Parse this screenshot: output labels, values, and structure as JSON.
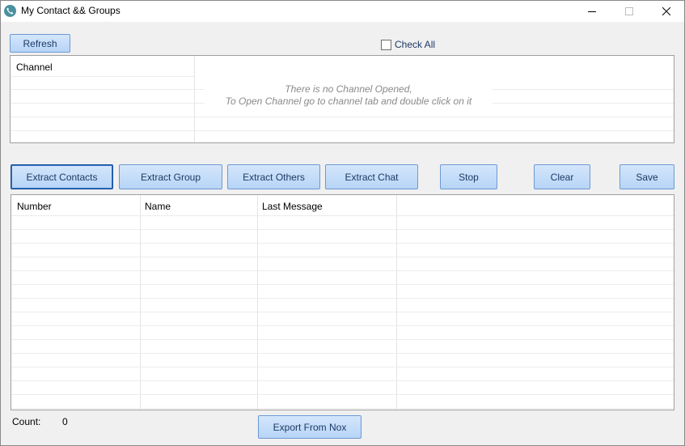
{
  "window": {
    "title": "My Contact && Groups",
    "icons": {
      "app": "phone-icon",
      "minimize": "minimize-icon",
      "maximize": "maximize-icon",
      "close": "close-icon"
    }
  },
  "toolbar": {
    "refresh_label": "Refresh",
    "check_all_label": "Check All",
    "check_all_checked": false
  },
  "channel_panel": {
    "column": "Channel",
    "empty_message_line1": "There is no Channel Opened,",
    "empty_message_line2": "To Open Channel go to channel tab and double click on it"
  },
  "actions": {
    "extract_contacts": "Extract Contacts",
    "extract_group": "Extract Group",
    "extract_others": "Extract Others",
    "extract_chat": "Extract Chat",
    "stop": "Stop",
    "clear": "Clear",
    "save": "Save"
  },
  "contacts_grid": {
    "columns": [
      "Number",
      "Name",
      "Last Message"
    ],
    "rows": []
  },
  "footer": {
    "count_label": "Count:",
    "count_value": "0",
    "export_label": "Export From Nox"
  },
  "colors": {
    "button_fill": "#b7d4f7",
    "button_border": "#6d99d3",
    "button_text": "#1c3a66",
    "window_bg": "#f0f0f0",
    "empty_message": "#8a8a8a"
  }
}
